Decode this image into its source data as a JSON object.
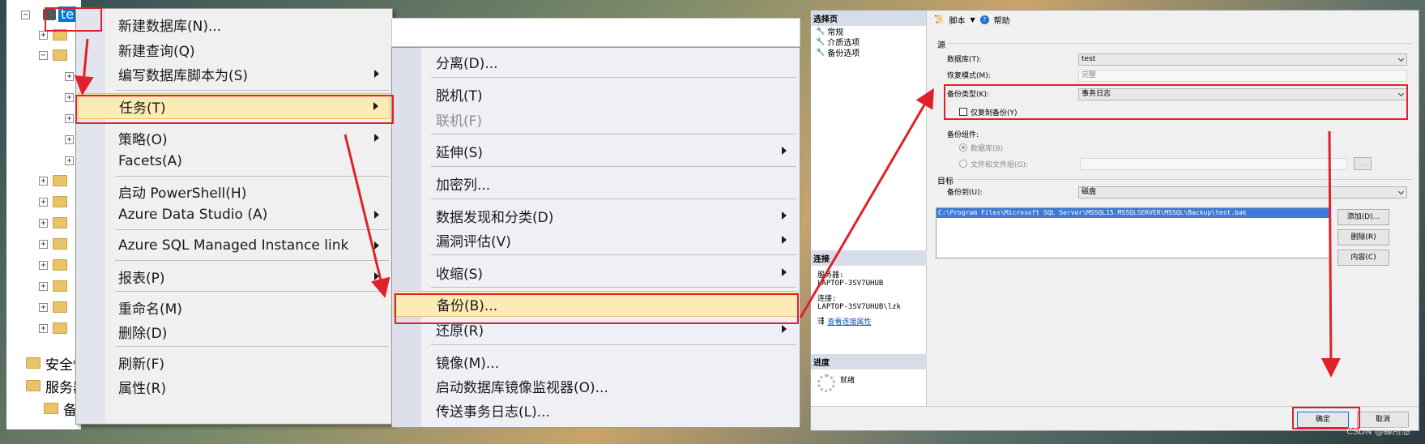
{
  "tree": {
    "root_label": "te",
    "security_label": "安全性",
    "server_objects_label": "服务器",
    "backup_devices_label": "备"
  },
  "menu1": {
    "items": [
      {
        "label": "新建数据库(N)...",
        "submenu": false
      },
      {
        "label": "新建查询(Q)",
        "submenu": false
      },
      {
        "label": "编写数据库脚本为(S)",
        "submenu": true
      },
      {
        "label": "任务(T)",
        "submenu": true
      },
      {
        "label": "策略(O)",
        "submenu": true
      },
      {
        "label": "Facets(A)",
        "submenu": false
      },
      {
        "label": "启动 PowerShell(H)",
        "submenu": false
      },
      {
        "label": "Azure Data Studio (A)",
        "submenu": true
      },
      {
        "label": "Azure SQL Managed Instance link",
        "submenu": true
      },
      {
        "label": "报表(P)",
        "submenu": true
      },
      {
        "label": "重命名(M)",
        "submenu": false
      },
      {
        "label": "删除(D)",
        "submenu": false
      },
      {
        "label": "刷新(F)",
        "submenu": false
      },
      {
        "label": "属性(R)",
        "submenu": false
      }
    ]
  },
  "menu2": {
    "items": [
      {
        "label": "分离(D)...",
        "submenu": false
      },
      {
        "label": "脱机(T)",
        "submenu": false
      },
      {
        "label": "联机(F)",
        "submenu": false,
        "disabled": true
      },
      {
        "label": "延伸(S)",
        "submenu": true
      },
      {
        "label": "加密列...",
        "submenu": false
      },
      {
        "label": "数据发现和分类(D)",
        "submenu": true
      },
      {
        "label": "漏洞评估(V)",
        "submenu": true
      },
      {
        "label": "收缩(S)",
        "submenu": true
      },
      {
        "label": "备份(B)...",
        "submenu": false
      },
      {
        "label": "还原(R)",
        "submenu": true
      },
      {
        "label": "镜像(M)...",
        "submenu": false
      },
      {
        "label": "启动数据库镜像监视器(O)...",
        "submenu": false
      },
      {
        "label": "传送事务日志(L)...",
        "submenu": false
      }
    ]
  },
  "dialog": {
    "select_page": {
      "header": "选择页",
      "pages": [
        "常规",
        "介质选项",
        "备份选项"
      ]
    },
    "connection": {
      "header": "连接",
      "server_label": "服务器:",
      "server_value": "LAPTOP-3SV7UHUB",
      "connection_label": "连接:",
      "connection_value": "LAPTOP-3SV7UHUB\\lzk",
      "view_props_link": "查看连接属性"
    },
    "progress": {
      "header": "进度",
      "status": "就绪"
    },
    "toolbar": {
      "script_label": "脚本",
      "help_label": "帮助"
    },
    "source": {
      "section": "源",
      "database_label": "数据库(T):",
      "database_value": "test",
      "recovery_label": "恢复模式(M):",
      "recovery_value": "完整",
      "backup_type_label": "备份类型(K):",
      "backup_type_value": "事务日志",
      "copy_only_label": "仅复制备份(Y)",
      "component_label": "备份组件:",
      "component_database": "数据库(B)",
      "component_files": "文件和文件组(G):"
    },
    "destination": {
      "section": "目标",
      "backup_to_label": "备份到(U):",
      "backup_to_value": "磁盘",
      "paths": [
        "C:\\Program Files\\Microsoft SQL Server\\MSSQL15.MSSQLSERVER\\MSSQL\\Backup\\test.bak"
      ],
      "add_button": "添加(D)...",
      "remove_button": "删除(R)",
      "contents_button": "内容(C)"
    },
    "footer": {
      "ok_button": "确定",
      "cancel_button": "取消"
    }
  },
  "watermark": "CSDN @蝉所想",
  "colors": {
    "annotation_red": "#e0202a",
    "menu_highlight": "#fcebb4",
    "selection_blue": "#3d7ad8"
  }
}
